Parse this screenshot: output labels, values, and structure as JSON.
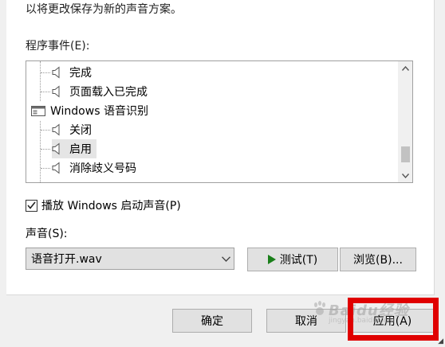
{
  "dialog": {
    "description": "以将更改保存为新的声音方案。",
    "events_label": "程序事件(E):",
    "tree": {
      "rows": [
        {
          "label": "完成",
          "type": "event"
        },
        {
          "label": "页面载入已完成",
          "type": "event"
        },
        {
          "label": "Windows 语音识别",
          "type": "group"
        },
        {
          "label": "关闭",
          "type": "event"
        },
        {
          "label": "启用",
          "type": "event",
          "selected": true
        },
        {
          "label": "消除歧义号码",
          "type": "event"
        }
      ]
    },
    "startup_sound_label": "播放 Windows 启动声音(P)",
    "startup_sound_checked": true,
    "sound_label": "声音(S):",
    "sound_select_value": "语音打开.wav",
    "test_button": "测试(T)",
    "browse_button": "浏览(B)...",
    "ok_button": "确定",
    "cancel_button": "取消",
    "apply_button": "应用(A)"
  },
  "watermark": {
    "text": "Baidu经验",
    "sub": "jingyan.baidu.com"
  },
  "colors": {
    "highlight": "#e00000",
    "play_icon": "#1a7f1a",
    "selected_row": "#e5e5e5"
  },
  "icons": {
    "event": "speaker-icon",
    "group": "windows-app-icon",
    "scroll_up": "chevron-up-icon",
    "scroll_down": "chevron-down-icon",
    "select": "chevron-down-icon",
    "test": "play-icon"
  }
}
